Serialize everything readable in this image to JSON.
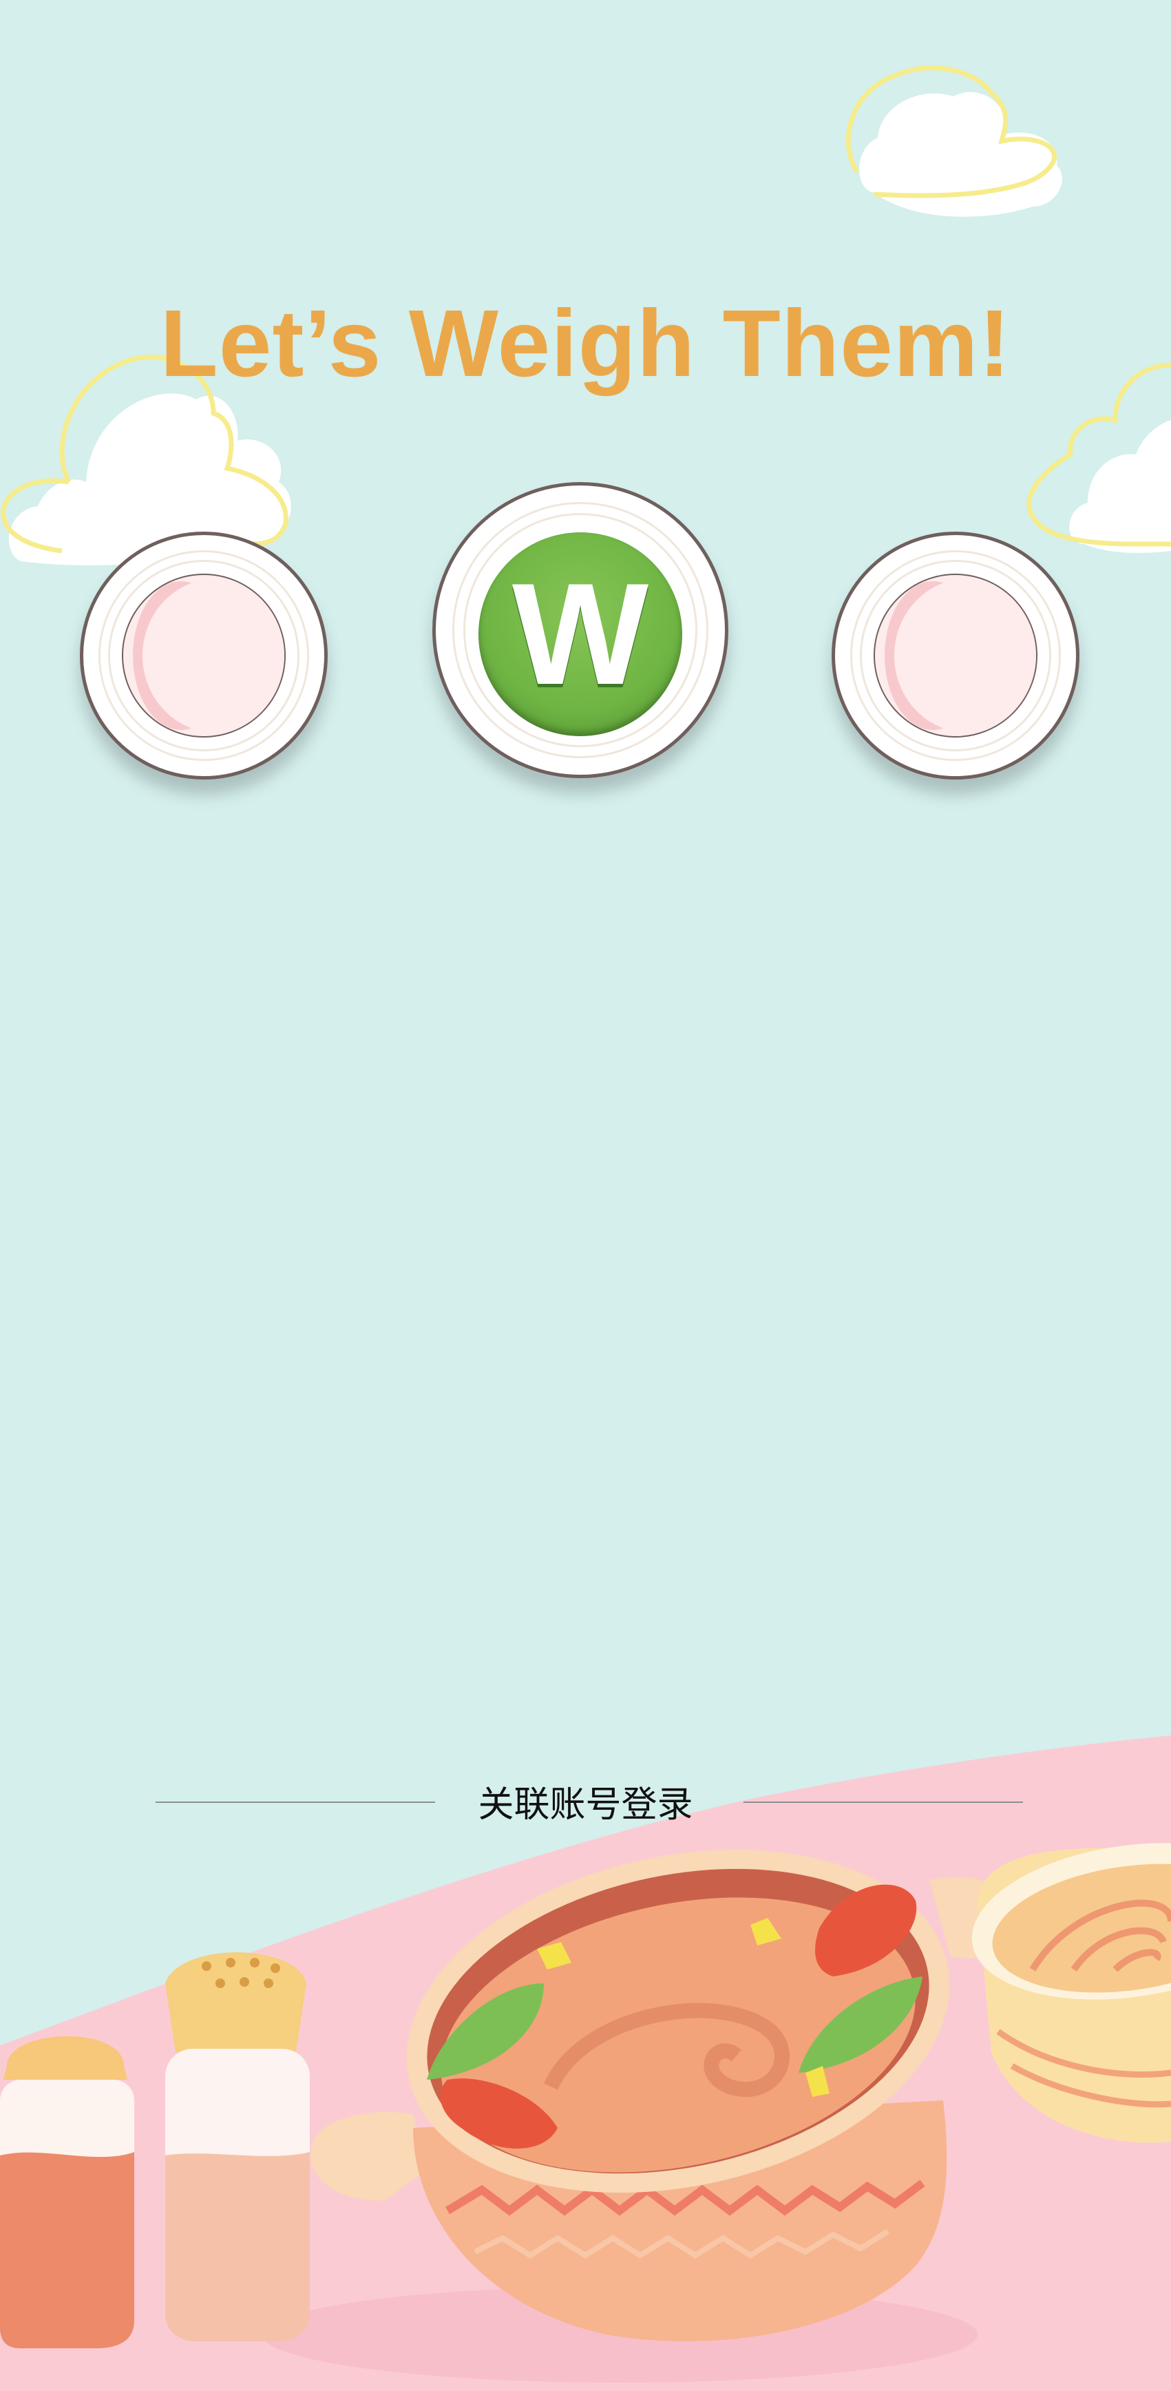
{
  "header": {
    "title": "Let’s Weigh Them!"
  },
  "plates": {
    "left": {
      "icon": "empty-plate-icon"
    },
    "center": {
      "button_label": "W",
      "icon": "weigh-button-icon"
    },
    "right": {
      "icon": "empty-plate-icon"
    }
  },
  "footer": {
    "login_label": "关联账号登录"
  },
  "colors": {
    "background": "#d4efec",
    "title": "#eba84a",
    "button_green": "#6fb544",
    "table_pink": "#fbcbd4"
  }
}
